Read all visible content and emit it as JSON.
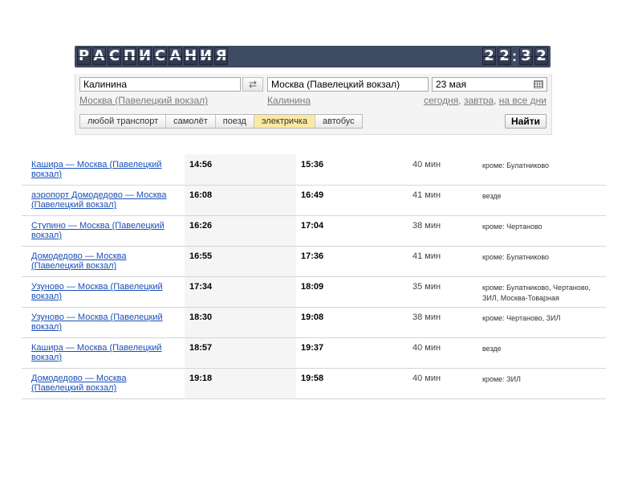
{
  "header": {
    "title_letters": [
      "Р",
      "А",
      "С",
      "П",
      "И",
      "С",
      "А",
      "Н",
      "И",
      "Я"
    ],
    "clock": {
      "h1": "2",
      "h2": "2",
      "m1": "3",
      "m2": "2"
    }
  },
  "search": {
    "from_value": "Калинина",
    "swap_icon": "⇄",
    "to_value": "Москва (Павелецкий вокзал)",
    "date_value": "23 мая",
    "from_hint": "Москва (Павелецкий вокзал)",
    "to_hint": "Калинина",
    "date_hints": {
      "today": "сегодня",
      "tomorrow": "завтра",
      "all_days": "на все дни"
    },
    "transport_tabs": [
      "любой транспорт",
      "самолёт",
      "поезд",
      "электричка",
      "автобус"
    ],
    "active_tab": "электричка",
    "find_label": "Найти"
  },
  "timetable": {
    "rows": [
      {
        "route": "Кашира — Москва (Павелецкий вокзал)",
        "departure": "14:56",
        "arrival": "15:36",
        "duration": "40 мин",
        "stops": "кроме: Булатниково"
      },
      {
        "route": "аэропорт Домодедово — Москва (Павелецкий вокзал)",
        "departure": "16:08",
        "arrival": "16:49",
        "duration": "41 мин",
        "stops": "везде"
      },
      {
        "route": "Ступино — Москва (Павелецкий вокзал)",
        "departure": "16:26",
        "arrival": "17:04",
        "duration": "38 мин",
        "stops": "кроме: Чертаново"
      },
      {
        "route": "Домодедово — Москва (Павелецкий вокзал)",
        "departure": "16:55",
        "arrival": "17:36",
        "duration": "41 мин",
        "stops": "кроме: Булатниково"
      },
      {
        "route": "Узуново — Москва (Павелецкий вокзал)",
        "departure": "17:34",
        "arrival": "18:09",
        "duration": "35 мин",
        "stops": "кроме: Булатниково, Чертаново, ЗИЛ, Москва-Товарная"
      },
      {
        "route": "Узуново — Москва (Павелецкий вокзал)",
        "departure": "18:30",
        "arrival": "19:08",
        "duration": "38 мин",
        "stops": "кроме: Чертаново, ЗИЛ"
      },
      {
        "route": "Кашира — Москва (Павелецкий вокзал)",
        "departure": "18:57",
        "arrival": "19:37",
        "duration": "40 мин",
        "stops": "везде"
      },
      {
        "route": "Домодедово — Москва (Павелецкий вокзал)",
        "departure": "19:18",
        "arrival": "19:58",
        "duration": "40 мин",
        "stops": "кроме: ЗИЛ"
      }
    ]
  },
  "colors": {
    "board": "#3f4a63",
    "link": "#1a4fb8",
    "active_tab": "#fbe8a2"
  }
}
